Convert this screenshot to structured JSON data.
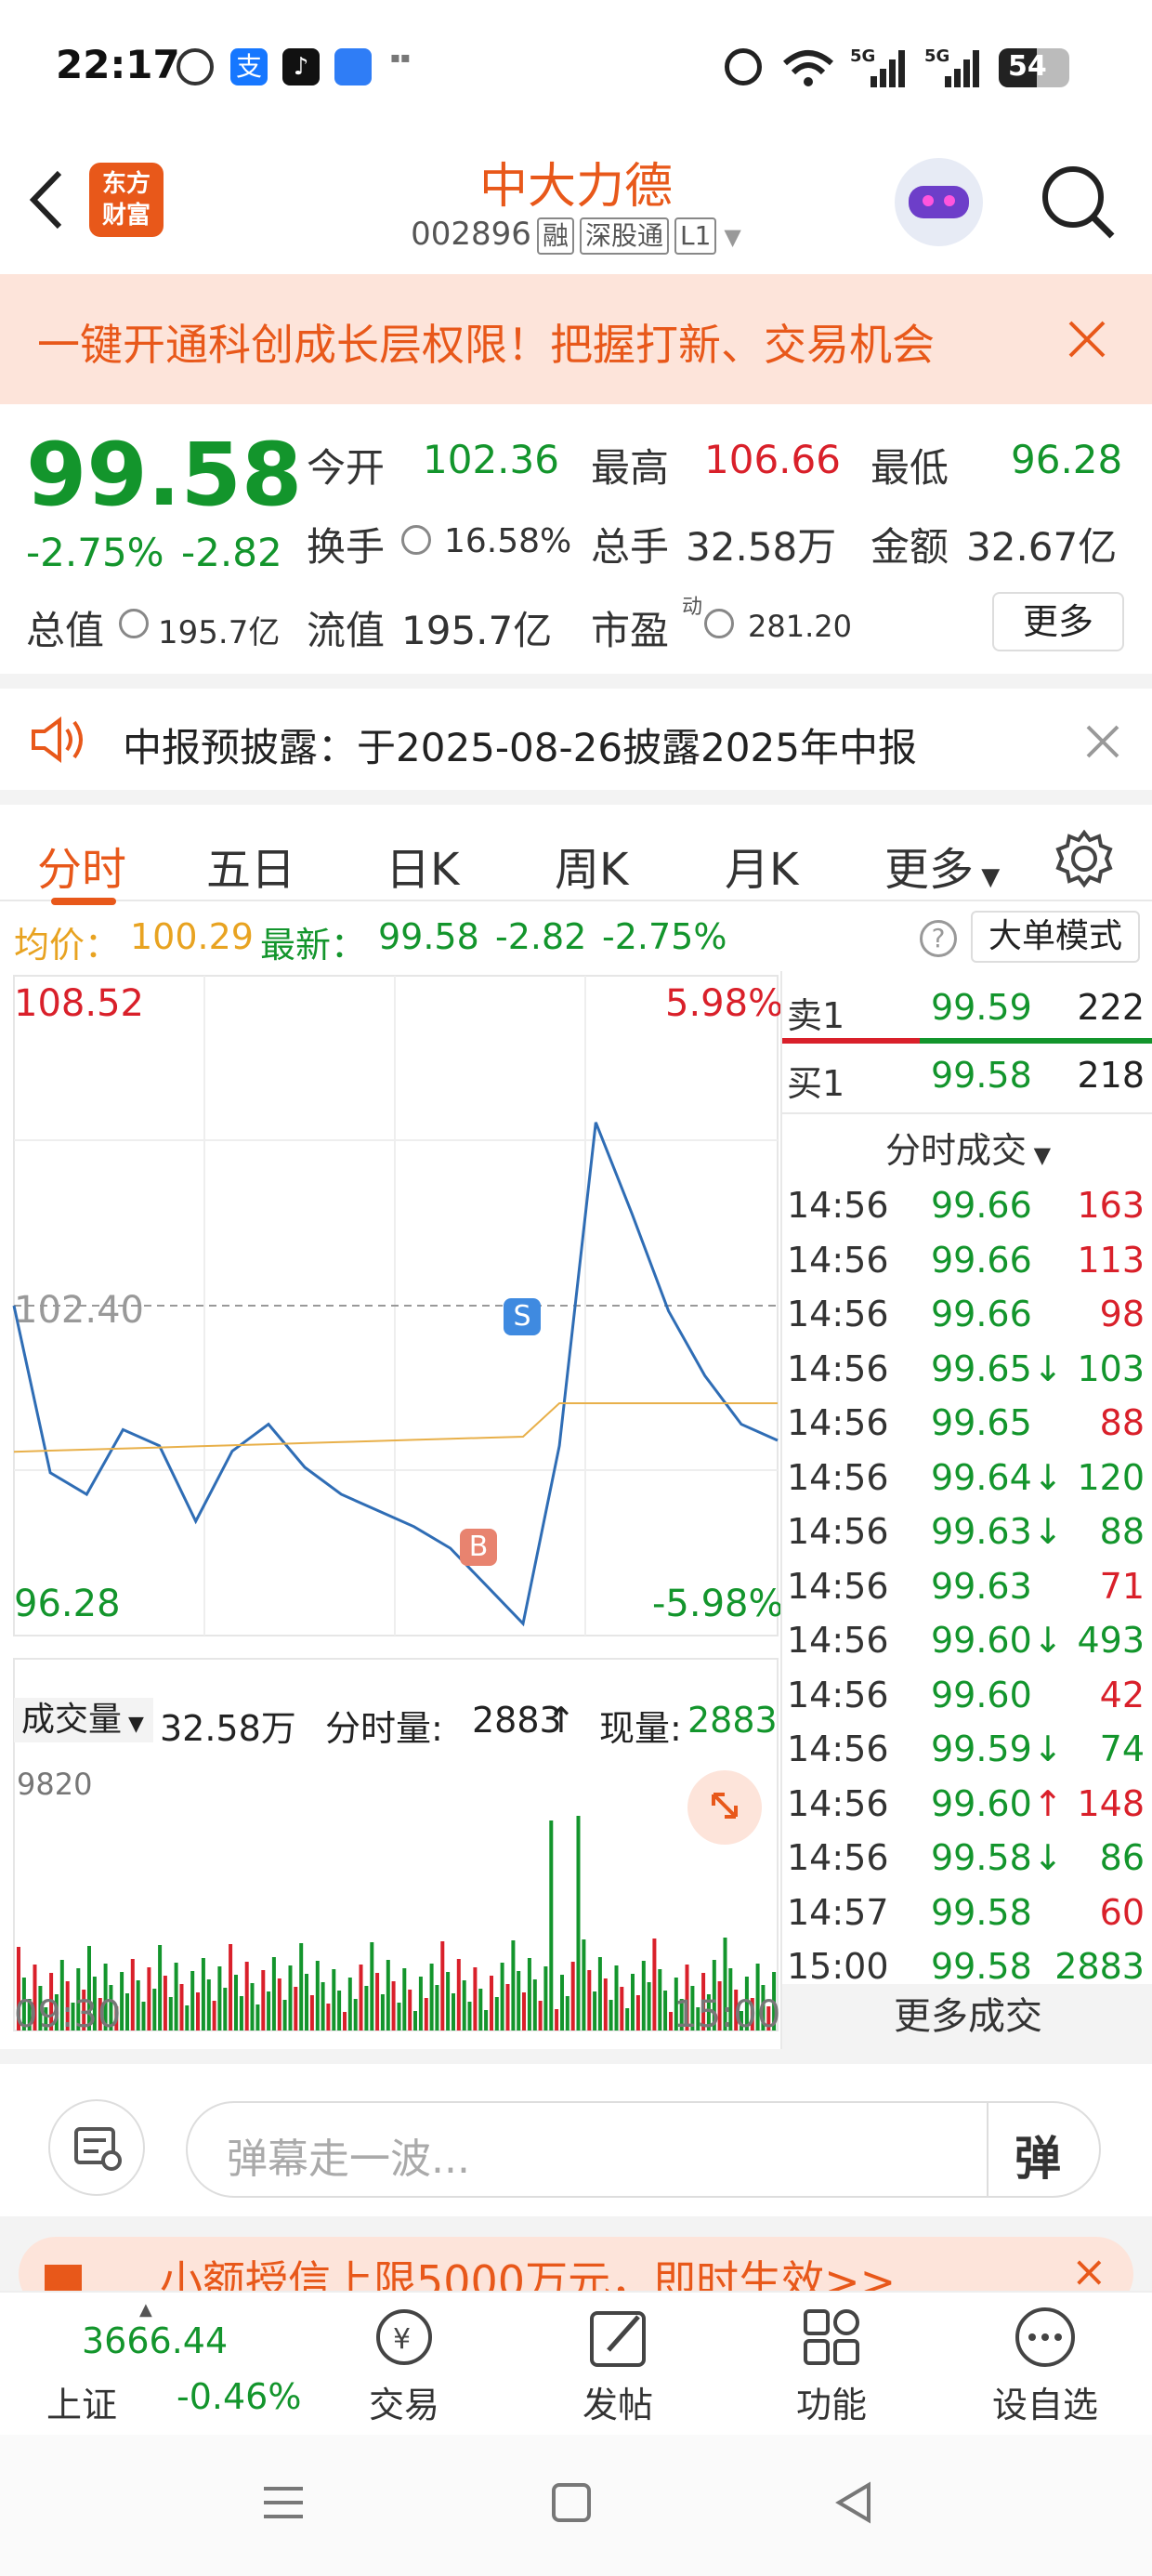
{
  "status": {
    "time": "22:17",
    "battery": "54"
  },
  "header": {
    "name": "中大力德",
    "code": "002896",
    "tags": [
      "融",
      "深股通",
      "L1"
    ],
    "logo": "东方\n财富"
  },
  "banner": {
    "text": "一键开通科创成长层权限！把握打新、交易机会"
  },
  "quote": {
    "price": "99.58",
    "pct": "-2.75%",
    "chg": "-2.82",
    "open_label": "今开",
    "open": "102.36",
    "high_label": "最高",
    "high": "106.66",
    "low_label": "最低",
    "low": "96.28",
    "turnover_label": "换手",
    "turnover": "16.58%",
    "vol_label": "总手",
    "vol": "32.58万",
    "amt_label": "金额",
    "amt": "32.67亿",
    "mcap_label": "总值",
    "mcap": "195.7亿",
    "float_label": "流值",
    "float": "195.7亿",
    "pe_label": "市盈",
    "pe_sup": "动",
    "pe": "281.20",
    "more": "更多"
  },
  "notice": {
    "text": "中报预披露：于2025-08-26披露2025年中报"
  },
  "tabs": [
    "分时",
    "五日",
    "日K",
    "周K",
    "月K",
    "更多"
  ],
  "info": {
    "avg_label": "均价：",
    "avg": "100.29",
    "latest_label": "最新：",
    "latest": "99.58",
    "chg": "-2.82",
    "pct": "-2.75%",
    "mode": "大单模式"
  },
  "chart": {
    "ymax": "108.52",
    "ymax_pct": "5.98%",
    "ymid": "102.40",
    "ymin": "96.28",
    "ymin_pct": "-5.98%",
    "t_start": "09:30",
    "t_end": "15:00",
    "vol_label": "成交量",
    "vol_total": "32.58万",
    "vol_min_label": "分时量:",
    "vol_min": "2883",
    "vol_now_label": "现量:",
    "vol_now": "2883",
    "vol_max": "9820",
    "marker_s": "S",
    "marker_b": "B"
  },
  "chart_data": {
    "type": "line",
    "xlabel": "",
    "ylabel": "",
    "ylim": [
      96.28,
      108.52
    ],
    "x": [
      "09:30",
      "15:00"
    ],
    "series": [
      {
        "name": "",
        "values": [
          102.4,
          99.3,
          98.9,
          100.1,
          99.8,
          98.4,
          99.7,
          100.2,
          99.4,
          98.9,
          98.6,
          98.3,
          97.9,
          97.2,
          96.5,
          99.8,
          105.8,
          104.1,
          102.3,
          101.1,
          100.2,
          99.9
        ]
      }
    ]
  },
  "orderbook": {
    "sell1_label": "卖1",
    "sell1_price": "99.59",
    "sell1_vol": "222",
    "buy1_label": "买1",
    "buy1_price": "99.58",
    "buy1_vol": "218",
    "ticks_title": "分时成交"
  },
  "ticks": [
    {
      "t": "14:56",
      "p": "99.66",
      "a": "",
      "v": "163",
      "c": "red"
    },
    {
      "t": "14:56",
      "p": "99.66",
      "a": "",
      "v": "113",
      "c": "red"
    },
    {
      "t": "14:56",
      "p": "99.66",
      "a": "",
      "v": "98",
      "c": "red"
    },
    {
      "t": "14:56",
      "p": "99.65",
      "a": "↓",
      "v": "103",
      "c": "green"
    },
    {
      "t": "14:56",
      "p": "99.65",
      "a": "",
      "v": "88",
      "c": "red"
    },
    {
      "t": "14:56",
      "p": "99.64",
      "a": "↓",
      "v": "120",
      "c": "green"
    },
    {
      "t": "14:56",
      "p": "99.63",
      "a": "↓",
      "v": "88",
      "c": "green"
    },
    {
      "t": "14:56",
      "p": "99.63",
      "a": "",
      "v": "71",
      "c": "red"
    },
    {
      "t": "14:56",
      "p": "99.60",
      "a": "↓",
      "v": "493",
      "c": "green"
    },
    {
      "t": "14:56",
      "p": "99.60",
      "a": "",
      "v": "42",
      "c": "red"
    },
    {
      "t": "14:56",
      "p": "99.59",
      "a": "↓",
      "v": "74",
      "c": "green"
    },
    {
      "t": "14:56",
      "p": "99.60",
      "a": "↑",
      "v": "148",
      "c": "red"
    },
    {
      "t": "14:56",
      "p": "99.58",
      "a": "↓",
      "v": "86",
      "c": "green"
    },
    {
      "t": "14:57",
      "p": "99.58",
      "a": "",
      "v": "60",
      "c": "red"
    },
    {
      "t": "15:00",
      "p": "99.58",
      "a": "",
      "v": "2883",
      "c": "green"
    }
  ],
  "more_trades": "更多成交",
  "danmu": {
    "placeholder": "弹幕走一波...",
    "btn": "弹"
  },
  "promo": {
    "text": "小额授信上限5000万元，即时生效>>"
  },
  "bottomnav": {
    "index_value": "3666.44",
    "index_name": "上证",
    "index_pct": "-0.46%",
    "items": [
      "交易",
      "发帖",
      "功能",
      "设自选"
    ]
  }
}
